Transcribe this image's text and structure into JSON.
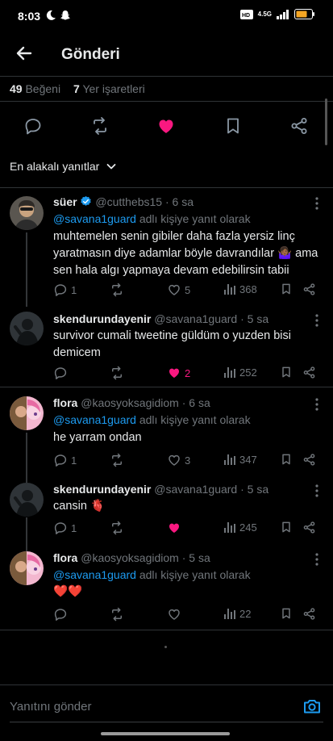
{
  "status_bar": {
    "time": "8:03",
    "network": "4.5G"
  },
  "header": {
    "title": "Gönderi"
  },
  "stats": {
    "likes_count": "49",
    "likes_label": "Beğeni",
    "bookmarks_count": "7",
    "bookmarks_label": "Yer işaretleri"
  },
  "sort": {
    "label": "En alakalı yanıtlar"
  },
  "colors": {
    "accent": "#1d9bf0",
    "like": "#f91880",
    "muted": "#71767b",
    "text": "#e7e9ea",
    "divider": "#2f3336"
  },
  "replies": [
    {
      "name": "süer",
      "verified": true,
      "handle": "@cutthebs15",
      "time": "· 6 sa",
      "replying_to": "@savana1guard",
      "replying_suffix": "adlı kişiye yanıt olarak",
      "text": "muhtemelen senin gibiler daha fazla yersiz linç yaratmasın diye adamlar böyle davrandılar 🤷🏾‍♀️ ama sen hala algı yapmaya devam edebilirsin tabii",
      "reply_count": "1",
      "retweet_count": "",
      "like_count": "5",
      "liked": false,
      "view_count": "368"
    },
    {
      "name": "skendurundayenir",
      "handle": "@savana1guard",
      "time": "· 5 sa",
      "text": "survivor cumali tweetine güldüm o yuzden bisi demicem",
      "reply_count": "",
      "retweet_count": "",
      "like_count": "2",
      "liked": true,
      "view_count": "252"
    },
    {
      "name": "flora",
      "handle": "@kaosyoksagidiom",
      "time": "· 6 sa",
      "replying_to": "@savana1guard",
      "replying_suffix": "adlı kişiye yanıt olarak",
      "text": "he yarram ondan",
      "reply_count": "1",
      "retweet_count": "",
      "like_count": "3",
      "liked": false,
      "view_count": "347"
    },
    {
      "name": "skendurundayenir",
      "handle": "@savana1guard",
      "time": "· 5 sa",
      "text": "cansin 🫀",
      "reply_count": "1",
      "retweet_count": "",
      "like_count": "",
      "liked": true,
      "view_count": "245"
    },
    {
      "name": "flora",
      "handle": "@kaosyoksagidiom",
      "time": "· 5 sa",
      "replying_to": "@savana1guard",
      "replying_suffix": "adlı kişiye yanıt olarak",
      "text": "❤️❤️",
      "reply_count": "",
      "retweet_count": "",
      "like_count": "",
      "liked": false,
      "view_count": "22"
    }
  ],
  "compose": {
    "placeholder": "Yanıtını gönder"
  }
}
